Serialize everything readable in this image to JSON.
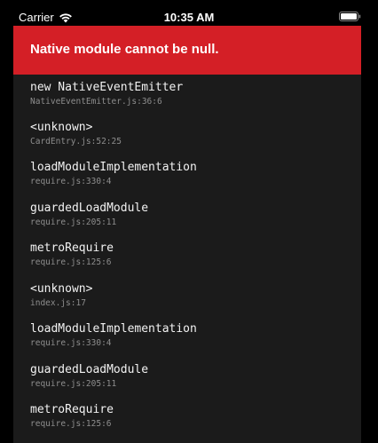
{
  "status_bar": {
    "carrier": "Carrier",
    "time": "10:35 AM",
    "icons": [
      "wifi-icon",
      "battery-icon"
    ]
  },
  "error": {
    "message": "Native module cannot be null.",
    "banner_color": "#d41f26",
    "background_color": "#1b1b1b"
  },
  "stack": [
    {
      "method": "new NativeEventEmitter",
      "location": "NativeEventEmitter.js:36:6"
    },
    {
      "method": "<unknown>",
      "location": "CardEntry.js:52:25"
    },
    {
      "method": "loadModuleImplementation",
      "location": "require.js:330:4"
    },
    {
      "method": "guardedLoadModule",
      "location": "require.js:205:11"
    },
    {
      "method": "metroRequire",
      "location": "require.js:125:6"
    },
    {
      "method": "<unknown>",
      "location": "index.js:17"
    },
    {
      "method": "loadModuleImplementation",
      "location": "require.js:330:4"
    },
    {
      "method": "guardedLoadModule",
      "location": "require.js:205:11"
    },
    {
      "method": "metroRequire",
      "location": "require.js:125:6"
    }
  ]
}
